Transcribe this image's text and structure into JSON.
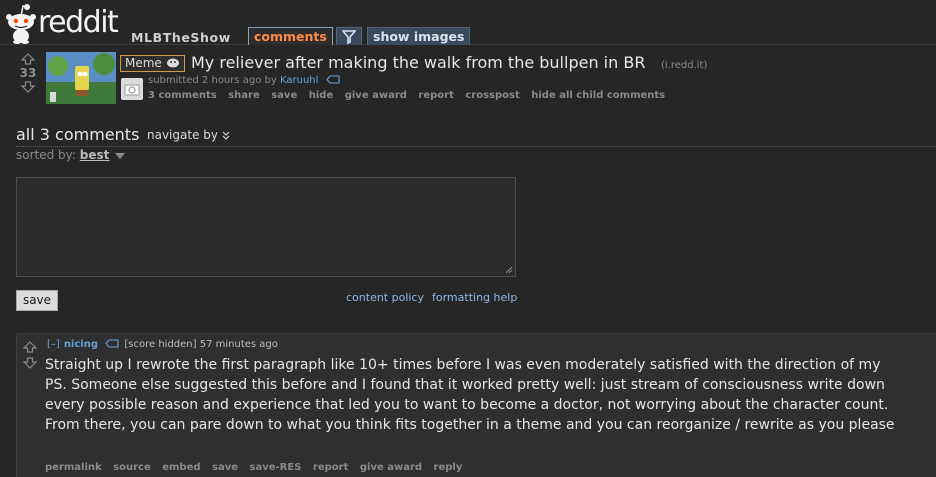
{
  "header": {
    "logo_text": "reddit",
    "subreddit": "MLBTheShow",
    "tabs": {
      "comments": "comments",
      "show_images": "show images"
    }
  },
  "post": {
    "score": "33",
    "flair": "Meme",
    "title": "My reliever after making the walk from the bullpen in BR",
    "domain": "(i.redd.it)",
    "submitted_prefix": "submitted 2 hours ago by ",
    "author": "Karuuhl",
    "buttons": [
      "3 comments",
      "share",
      "save",
      "hide",
      "give award",
      "report",
      "crosspost",
      "hide all child comments"
    ]
  },
  "comments_area": {
    "title": "all 3 comments",
    "navigate": "navigate by",
    "sorted_label": "sorted by: ",
    "sorted_value": "best",
    "save_label": "save",
    "content_policy": "content policy",
    "formatting_help": "formatting help"
  },
  "comment": {
    "collapse": "[–]",
    "author": "nicing",
    "score": "[score hidden]",
    "time": "57 minutes ago",
    "body": "Straight up I rewrote the first paragraph like 10+ times before I was even moderately satisfied with the direction of my PS. Someone else suggested this before and I found that it worked pretty well: just stream of consciousness write down every possible reason and experience that led you to want to become a doctor, not worrying about the character count. From there, you can pare down to what you think fits together in a theme and you can reorganize / rewrite as you please",
    "buttons": [
      "permalink",
      "source",
      "embed",
      "save",
      "save-RES",
      "report",
      "give award",
      "reply"
    ]
  }
}
